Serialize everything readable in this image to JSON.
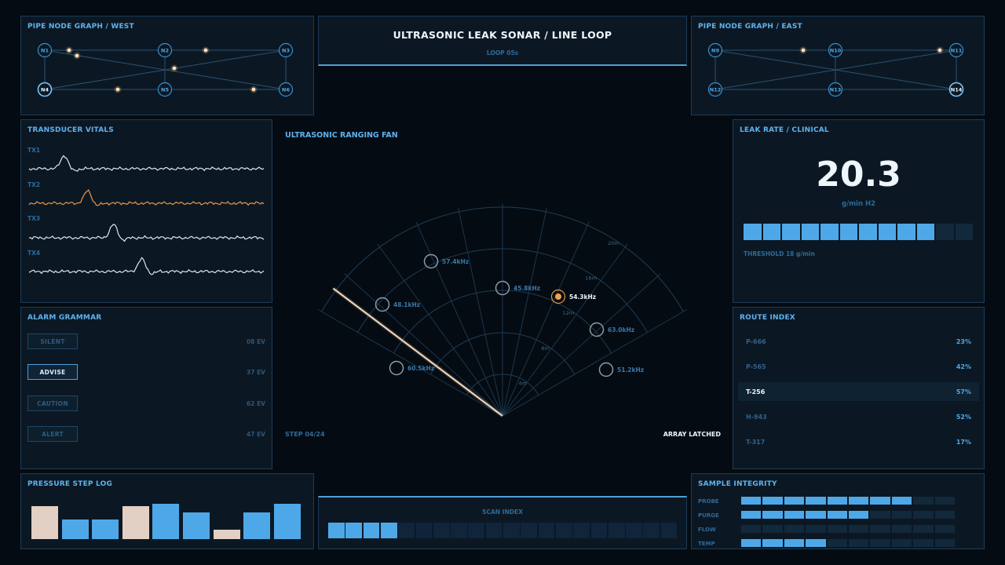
{
  "header": {
    "title": "ULTRASONIC LEAK SONAR / LINE LOOP",
    "subtitle": "LOOP 05s"
  },
  "graph_west": {
    "title": "PIPE NODE GRAPH / WEST",
    "nodes": [
      {
        "label": "N1",
        "bold": false
      },
      {
        "label": "N2",
        "bold": false
      },
      {
        "label": "N3",
        "bold": false
      },
      {
        "label": "N4",
        "bold": true
      },
      {
        "label": "N5",
        "bold": false
      },
      {
        "label": "N6",
        "bold": false
      }
    ]
  },
  "graph_east": {
    "title": "PIPE NODE GRAPH / EAST",
    "nodes": [
      {
        "label": "N9",
        "bold": false
      },
      {
        "label": "N10",
        "bold": false
      },
      {
        "label": "N11",
        "bold": false
      },
      {
        "label": "N12",
        "bold": false
      },
      {
        "label": "N13",
        "bold": false
      },
      {
        "label": "N14",
        "bold": true
      }
    ]
  },
  "vitals": {
    "title": "TRANSDUCER VITALS",
    "channels": [
      {
        "label": "TX1",
        "color": "#d8e8f2"
      },
      {
        "label": "TX2",
        "color": "#e8964a"
      },
      {
        "label": "TX3",
        "color": "#d8e8f2"
      },
      {
        "label": "TX4",
        "color": "#d8e8f2"
      }
    ]
  },
  "alarm": {
    "title": "ALARM GRAMMAR",
    "levels": [
      {
        "label": "SILENT",
        "count": "08 EV",
        "active": false
      },
      {
        "label": "ADVISE",
        "count": "37 EV",
        "active": true
      },
      {
        "label": "CAUTION",
        "count": "62 EV",
        "active": false
      },
      {
        "label": "ALERT",
        "count": "47 EV",
        "active": false
      }
    ]
  },
  "pressure_log": {
    "title": "PRESSURE STEP LOG",
    "bar_fractions": [
      0.93,
      0.55,
      0.55,
      0.93,
      1.0,
      0.75,
      0.27,
      0.75,
      1.0
    ],
    "bar_colors": [
      "#e2d0c4",
      "#4ea8e8",
      "#4ea8e8",
      "#e2d0c4",
      "#4ea8e8",
      "#4ea8e8",
      "#e2d0c4",
      "#4ea8e8",
      "#4ea8e8"
    ]
  },
  "sonar": {
    "title": "ULTRASONIC RANGING FAN",
    "step": "STEP 04/24",
    "status": "ARRAY LATCHED",
    "range_labels": [
      "4m",
      "8m",
      "12m",
      "16m",
      "20m"
    ],
    "contacts": [
      {
        "freq": "57.4kHz",
        "alert": false
      },
      {
        "freq": "45.8kHz",
        "alert": false
      },
      {
        "freq": "54.3kHz",
        "alert": true
      },
      {
        "freq": "48.1kHz",
        "alert": false
      },
      {
        "freq": "63.0kHz",
        "alert": false
      },
      {
        "freq": "60.5kHz",
        "alert": false
      },
      {
        "freq": "51.2kHz",
        "alert": false
      }
    ]
  },
  "scan_index": {
    "title": "SCAN INDEX",
    "filled": 4,
    "total": 20
  },
  "leak_rate": {
    "title": "LEAK RATE / CLINICAL",
    "value": "20.3",
    "unit": "g/min H2",
    "segments_filled": 10,
    "segments_total": 12,
    "threshold": "THRESHOLD 18 g/min"
  },
  "route_index": {
    "title": "ROUTE INDEX",
    "routes": [
      {
        "name": "P-666",
        "pct": "23%",
        "selected": false
      },
      {
        "name": "P-565",
        "pct": "42%",
        "selected": false
      },
      {
        "name": "T-256",
        "pct": "57%",
        "selected": true
      },
      {
        "name": "H-943",
        "pct": "52%",
        "selected": false
      },
      {
        "name": "T-317",
        "pct": "17%",
        "selected": false
      }
    ]
  },
  "integrity": {
    "title": "SAMPLE INTEGRITY",
    "rows": [
      {
        "label": "PROBE",
        "filled": 8
      },
      {
        "label": "PURGE",
        "filled": 6
      },
      {
        "label": "FLOW",
        "filled": 0
      },
      {
        "label": "TEMP",
        "filled": 4
      }
    ],
    "total": 10
  }
}
